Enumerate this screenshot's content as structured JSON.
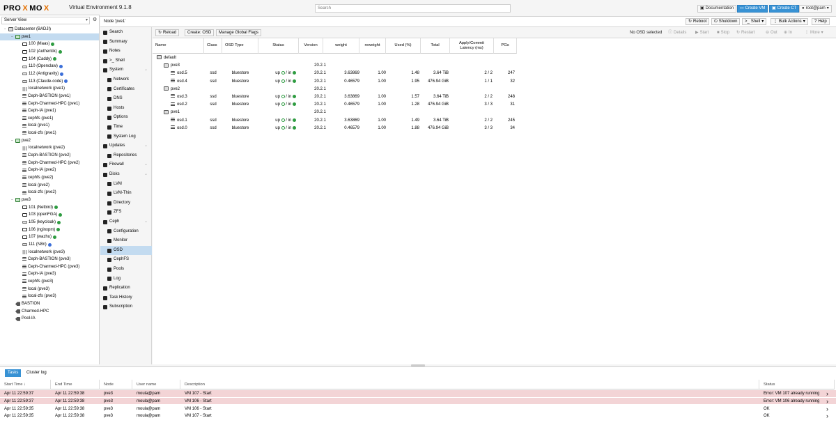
{
  "header": {
    "logo_a": "PRO",
    "logo_x": "X",
    "logo_b": "MO",
    "logo_x2": "X",
    "product": "Virtual Environment 9.1.8",
    "search_placeholder": "Search",
    "buttons": {
      "documentation": "Documentation",
      "create_vm": "Create VM",
      "create_ct": "Create CT",
      "user": "root@pam"
    }
  },
  "tree": {
    "view": "Server View",
    "items": [
      {
        "label": "Datacenter (BADJI)",
        "kind": "dc",
        "indent": 0,
        "toggle": "−"
      },
      {
        "label": "pve1",
        "kind": "node",
        "indent": 1,
        "toggle": "−",
        "sel": true
      },
      {
        "label": "100 (Maas)",
        "kind": "vm",
        "indent": 2,
        "dot": "g"
      },
      {
        "label": "102 (Authentik)",
        "kind": "vm",
        "indent": 2,
        "dot": "g"
      },
      {
        "label": "104 (Caddy)",
        "kind": "vm",
        "indent": 2,
        "dot": "g"
      },
      {
        "label": "110 (Openclaw)",
        "kind": "ct",
        "indent": 2,
        "dot": "b"
      },
      {
        "label": "112 (Antigravity)",
        "kind": "ct",
        "indent": 2,
        "dot": "b"
      },
      {
        "label": "113 (Claude-code)",
        "kind": "ct",
        "indent": 2,
        "dot": "b"
      },
      {
        "label": "localnetwork (pve1)",
        "kind": "net",
        "indent": 2
      },
      {
        "label": "Ceph-BASTION (pve1)",
        "kind": "stor",
        "indent": 2
      },
      {
        "label": "Ceph-Charmed-HPC (pve1)",
        "kind": "stor",
        "indent": 2
      },
      {
        "label": "Ceph-IA (pve1)",
        "kind": "stor",
        "indent": 2
      },
      {
        "label": "cephfs (pve1)",
        "kind": "stor",
        "indent": 2
      },
      {
        "label": "local (pve1)",
        "kind": "stor",
        "indent": 2
      },
      {
        "label": "local-zfs (pve1)",
        "kind": "stor",
        "indent": 2
      },
      {
        "label": "pve2",
        "kind": "node",
        "indent": 1,
        "toggle": "−"
      },
      {
        "label": "localnetwork (pve2)",
        "kind": "net",
        "indent": 2
      },
      {
        "label": "Ceph-BASTION (pve2)",
        "kind": "stor",
        "indent": 2
      },
      {
        "label": "Ceph-Charmed-HPC (pve2)",
        "kind": "stor",
        "indent": 2
      },
      {
        "label": "Ceph-IA (pve2)",
        "kind": "stor",
        "indent": 2
      },
      {
        "label": "cephfs (pve2)",
        "kind": "stor",
        "indent": 2
      },
      {
        "label": "local (pve2)",
        "kind": "stor",
        "indent": 2
      },
      {
        "label": "local-zfs (pve2)",
        "kind": "stor",
        "indent": 2
      },
      {
        "label": "pve3",
        "kind": "node",
        "indent": 1,
        "toggle": "−"
      },
      {
        "label": "101 (Netbird)",
        "kind": "vm",
        "indent": 2,
        "dot": "g"
      },
      {
        "label": "103 (openFGA)",
        "kind": "vm",
        "indent": 2,
        "dot": "g"
      },
      {
        "label": "105 (keycloak)",
        "kind": "ct",
        "indent": 2,
        "dot": "g"
      },
      {
        "label": "106 (nginxpm)",
        "kind": "vm",
        "indent": 2,
        "dot": "g"
      },
      {
        "label": "107 (wazhu)",
        "kind": "vm",
        "indent": 2,
        "dot": "g"
      },
      {
        "label": "111 (N8n)",
        "kind": "ct",
        "indent": 2,
        "dot": "b"
      },
      {
        "label": "localnetwork (pve3)",
        "kind": "net",
        "indent": 2
      },
      {
        "label": "Ceph-BASTION (pve3)",
        "kind": "stor",
        "indent": 2
      },
      {
        "label": "Ceph-Charmed-HPC (pve3)",
        "kind": "stor",
        "indent": 2
      },
      {
        "label": "Ceph-IA (pve3)",
        "kind": "stor",
        "indent": 2
      },
      {
        "label": "cephfs (pve3)",
        "kind": "stor",
        "indent": 2
      },
      {
        "label": "local (pve3)",
        "kind": "stor",
        "indent": 2
      },
      {
        "label": "local-zfs (pve3)",
        "kind": "stor",
        "indent": 2
      },
      {
        "label": "BASTION",
        "kind": "pool",
        "indent": 1
      },
      {
        "label": "Charmed-HPC",
        "kind": "pool",
        "indent": 1
      },
      {
        "label": "Pool-IA",
        "kind": "pool",
        "indent": 1
      }
    ]
  },
  "main": {
    "node_title": "Node 'pve1'",
    "actions": {
      "reboot": "Reboot",
      "shutdown": "Shutdown",
      "shell": "Shell",
      "bulk": "Bulk Actions",
      "help": "Help"
    }
  },
  "nav": [
    {
      "label": "Search",
      "indent": 0
    },
    {
      "label": "Summary",
      "indent": 0
    },
    {
      "label": "Notes",
      "indent": 0
    },
    {
      "label": ">_ Shell",
      "indent": 0
    },
    {
      "label": "System",
      "indent": 0,
      "chev": true
    },
    {
      "label": "Network",
      "indent": 1
    },
    {
      "label": "Certificates",
      "indent": 1
    },
    {
      "label": "DNS",
      "indent": 1
    },
    {
      "label": "Hosts",
      "indent": 1
    },
    {
      "label": "Options",
      "indent": 1
    },
    {
      "label": "Time",
      "indent": 1
    },
    {
      "label": "System Log",
      "indent": 1
    },
    {
      "label": "Updates",
      "indent": 0,
      "chev": true
    },
    {
      "label": "Repositories",
      "indent": 1
    },
    {
      "label": "Firewall",
      "indent": 0,
      "chev": true
    },
    {
      "label": "Disks",
      "indent": 0,
      "chev": true
    },
    {
      "label": "LVM",
      "indent": 1
    },
    {
      "label": "LVM-Thin",
      "indent": 1
    },
    {
      "label": "Directory",
      "indent": 1
    },
    {
      "label": "ZFS",
      "indent": 1
    },
    {
      "label": "Ceph",
      "indent": 0,
      "chev": true
    },
    {
      "label": "Configuration",
      "indent": 1
    },
    {
      "label": "Monitor",
      "indent": 1
    },
    {
      "label": "OSD",
      "indent": 1,
      "sel": true
    },
    {
      "label": "CephFS",
      "indent": 1
    },
    {
      "label": "Pools",
      "indent": 1
    },
    {
      "label": "Log",
      "indent": 1
    },
    {
      "label": "Replication",
      "indent": 0
    },
    {
      "label": "Task History",
      "indent": 0
    },
    {
      "label": "Subscription",
      "indent": 0
    }
  ],
  "toolbar": {
    "reload": "Reload",
    "create_osd": "Create: OSD",
    "flags": "Manage Global Flags",
    "no_sel": "No OSD selected",
    "details": "Details",
    "start": "Start",
    "stop": "Stop",
    "restart": "Restart",
    "out": "Out",
    "in": "In",
    "more": "More"
  },
  "grid": {
    "columns": [
      "Name",
      "Class",
      "OSD Type",
      "Status",
      "Version",
      "weight",
      "reweight",
      "Used (%)",
      "Total",
      "Apply/Commit Latency (ms)",
      "PGs"
    ],
    "rows": [
      {
        "name": "default",
        "level": 0,
        "kind": "root",
        "version": ""
      },
      {
        "name": "pve3",
        "level": 1,
        "kind": "host",
        "version": "20.2.1"
      },
      {
        "name": "osd.5",
        "level": 2,
        "kind": "osd",
        "class": "ssd",
        "type": "bluestore",
        "status": "up",
        "inout": "in",
        "version": "20.2.1",
        "weight": "3.63869",
        "reweight": "1.00",
        "used": "1.48",
        "total": "3.64 TiB",
        "latency": "2 / 2",
        "pgs": "247"
      },
      {
        "name": "osd.4",
        "level": 2,
        "kind": "osd",
        "class": "ssd",
        "type": "bluestore",
        "status": "up",
        "inout": "in",
        "version": "20.2.1",
        "weight": "0.46579",
        "reweight": "1.00",
        "used": "1.95",
        "total": "476.94 GiB",
        "latency": "1 / 1",
        "pgs": "32"
      },
      {
        "name": "pve2",
        "level": 1,
        "kind": "host",
        "version": "20.2.1"
      },
      {
        "name": "osd.3",
        "level": 2,
        "kind": "osd",
        "class": "ssd",
        "type": "bluestore",
        "status": "up",
        "inout": "in",
        "version": "20.2.1",
        "weight": "3.63869",
        "reweight": "1.00",
        "used": "1.57",
        "total": "3.64 TiB",
        "latency": "2 / 2",
        "pgs": "248"
      },
      {
        "name": "osd.2",
        "level": 2,
        "kind": "osd",
        "class": "ssd",
        "type": "bluestore",
        "status": "up",
        "inout": "in",
        "version": "20.2.1",
        "weight": "0.46579",
        "reweight": "1.00",
        "used": "1.28",
        "total": "476.94 GiB",
        "latency": "3 / 3",
        "pgs": "31"
      },
      {
        "name": "pve1",
        "level": 1,
        "kind": "host",
        "version": "20.2.1"
      },
      {
        "name": "osd.1",
        "level": 2,
        "kind": "osd",
        "class": "ssd",
        "type": "bluestore",
        "status": "up",
        "inout": "in",
        "version": "20.2.1",
        "weight": "3.63869",
        "reweight": "1.00",
        "used": "1.49",
        "total": "3.64 TiB",
        "latency": "2 / 2",
        "pgs": "245"
      },
      {
        "name": "osd.0",
        "level": 2,
        "kind": "osd",
        "class": "ssd",
        "type": "bluestore",
        "status": "up",
        "inout": "in",
        "version": "20.2.1",
        "weight": "0.46579",
        "reweight": "1.00",
        "used": "1.88",
        "total": "476.94 GiB",
        "latency": "3 / 3",
        "pgs": "34"
      }
    ]
  },
  "bottom": {
    "tabs": [
      "Tasks",
      "Cluster log"
    ],
    "columns": [
      "Start Time ↓",
      "End Time",
      "Node",
      "User name",
      "Description",
      "Status"
    ],
    "rows": [
      {
        "start": "Apr 11 22:59:37",
        "end": "Apr 11 22:59:38",
        "node": "pve3",
        "user": "moula@pam",
        "desc": "VM 107 - Start",
        "status": "Error: VM 107 already running",
        "err": true
      },
      {
        "start": "Apr 11 22:59:37",
        "end": "Apr 11 22:59:38",
        "node": "pve3",
        "user": "moula@pam",
        "desc": "VM 106 - Start",
        "status": "Error: VM 106 already running",
        "err": true
      },
      {
        "start": "Apr 11 22:59:35",
        "end": "Apr 11 22:59:38",
        "node": "pve3",
        "user": "moula@pam",
        "desc": "VM 106 - Start",
        "status": "OK",
        "err": false
      },
      {
        "start": "Apr 11 22:59:35",
        "end": "Apr 11 22:59:38",
        "node": "pve3",
        "user": "moula@pam",
        "desc": "VM 107 - Start",
        "status": "OK",
        "err": false
      }
    ]
  },
  "colors": {
    "accent": "#3892d4",
    "selected": "#c3dbf0",
    "error_row": "#f3d4d6",
    "running": "#2e9c41",
    "ct_running": "#3c6fd9"
  }
}
